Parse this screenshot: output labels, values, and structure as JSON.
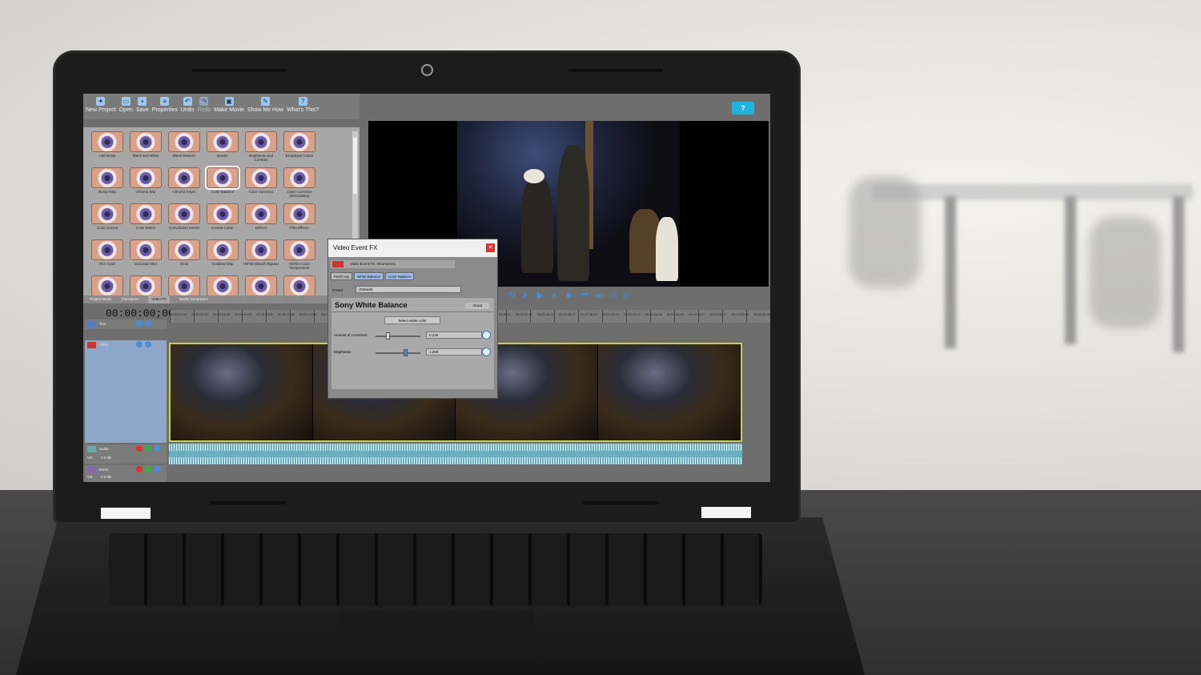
{
  "toolbar": {
    "new_project": "New Project",
    "open": "Open",
    "save": "Save",
    "properties": "Properties",
    "undo": "Undo",
    "redo": "Redo",
    "make_movie": "Make Movie",
    "show_me_how": "Show Me How",
    "whats_this": "What's This?"
  },
  "help_label": "?",
  "video_fx": [
    "Add Noise",
    "Black and White",
    "Black Restore",
    "Border",
    "Brightness and Contrast",
    "Broadcast Colors",
    "Bump Map",
    "Chroma Blur",
    "Chroma Keyer",
    "Color Balance",
    "Color Corrector",
    "Color Corrector (Secondary)",
    "Color Curves",
    "Color Match",
    "Convolution Kernel",
    "Cookie Cutter",
    "Deform",
    "Film Effects",
    "Film Grain",
    "Gaussian Blur",
    "Glow",
    "Gradient Map",
    "HitFilm Bleach Bypass",
    "HitFilm Color Temperature",
    "",
    "",
    "",
    "",
    "",
    ""
  ],
  "selected_fx": "Color Balance",
  "panel_tabs": [
    "Project Media",
    "Transitions",
    "Video FX",
    "Media Generators"
  ],
  "active_tab": "Video FX",
  "timecode": "00:00:00;00",
  "ruler_labels": [
    "00:00:00;00",
    "00:00:02;02",
    "00:00:04;03",
    "00:00:06;03",
    "00:00:08;05",
    "00:00:10;05",
    "00:00:12;06",
    "00:00:14;06",
    "00:00:16;07",
    "00:00:18;07",
    "00:00:20;08",
    "00:00:22;09",
    "00:00:24;10",
    "00:00:26;10",
    "00:00:28;10",
    "00:00:30;11",
    "00:00:32;11",
    "00:00:34;12",
    "00:00:36;12",
    "00:00:38;14",
    "00:00:40;14",
    "00:00:42;15",
    "00:00:44;16",
    "00:00:46;16",
    "00:00:48;17",
    "00:00:50;17",
    "00:00:52;18",
    "00:00:54;18"
  ],
  "tracks": {
    "text": "Text",
    "video": "Video",
    "audio": "Audio",
    "audio_vol": "0.0 dB",
    "music": "Music",
    "music_vol": "0.0 dB",
    "vol_label": "Vol:"
  },
  "dialog": {
    "title": "Video Event FX",
    "fx_header": "Video Event FX:  Drummers1",
    "chain": [
      "Pan/Crop",
      "White Balance",
      "Color Balance"
    ],
    "preset_label": "Preset:",
    "preset_value": "(Default)",
    "plugin_title": "Sony White Balance",
    "about": "About",
    "select_white": "Select white color",
    "amount_label": "Amount of correction:",
    "amount_value": "0.236",
    "amount_level": 0.236,
    "brightness_label": "Brightness:",
    "brightness_value": "1.269",
    "brightness_level": 0.63
  },
  "colors": {
    "accent": "#1fb3e4",
    "video_track_border": "#c9d43a",
    "audio_wave": "#6ab0c0"
  }
}
